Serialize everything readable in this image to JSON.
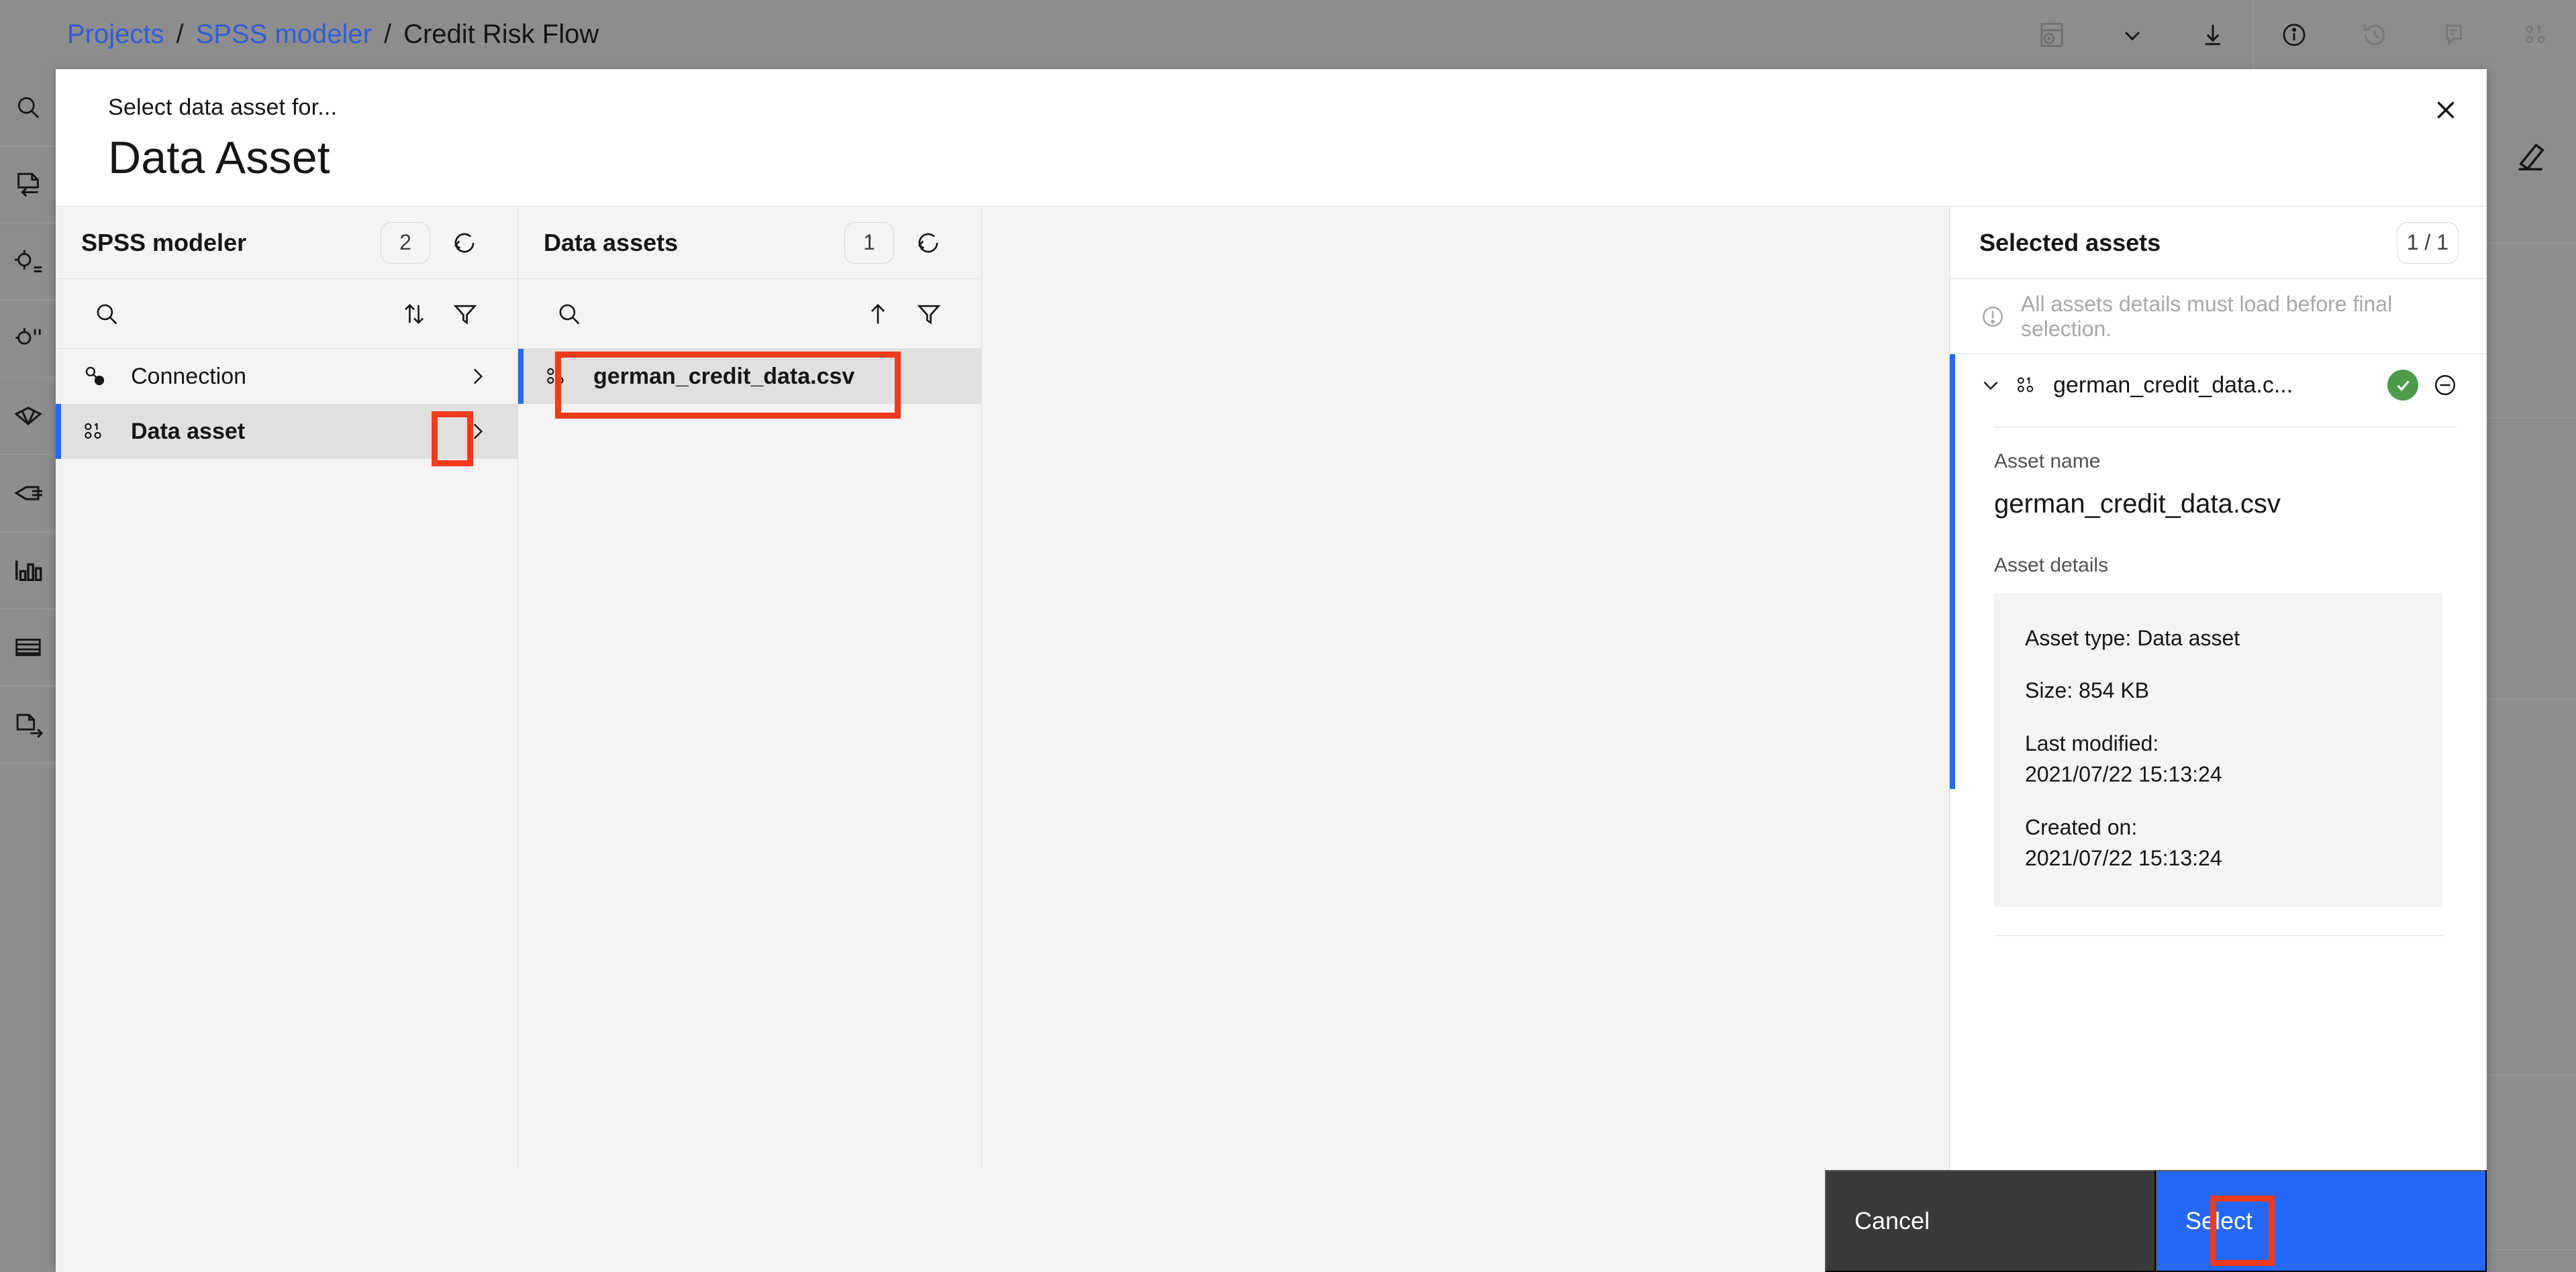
{
  "app": {
    "breadcrumb": [
      {
        "label": "Projects",
        "type": "link"
      },
      {
        "label": "/",
        "type": "sep"
      },
      {
        "label": "SPSS modeler",
        "type": "link"
      },
      {
        "label": "/",
        "type": "sep"
      },
      {
        "label": "Credit Risk Flow",
        "type": "current"
      }
    ],
    "toolbar_icons": [
      "run-flow-icon",
      "chevron-down-icon",
      "download-icon",
      "info-icon",
      "history-icon",
      "comment-icon",
      "data-asset-icon"
    ],
    "left_rail_icons": [
      "search-icon",
      "import-node-icon",
      "record-ops-icon",
      "field-ops-icon",
      "modeling-icon",
      "outputs-icon",
      "graphs-icon",
      "table-icon",
      "export-node-icon"
    ],
    "right_rail_icons": [
      "edit-pencil-icon"
    ]
  },
  "modal": {
    "eyebrow": "Select data asset for...",
    "title": "Data Asset",
    "close_label": "Close",
    "colors": {
      "accent_blue": "#2668f5",
      "annotation_red": "#ef3a1e",
      "status_green": "#4c9c4c",
      "cancel_dark": "#393939"
    },
    "columns": [
      {
        "name": "spss-modeler",
        "title": "SPSS modeler",
        "count": "2",
        "refresh_icon": "refresh-icon",
        "search_placeholder": "",
        "tools": [
          "search-icon",
          "sort-icon",
          "filter-icon"
        ],
        "items": [
          {
            "label": "Connection",
            "icon": "connection-icon",
            "selected": false,
            "chevron": true
          },
          {
            "label": "Data asset",
            "icon": "data-asset-icon",
            "selected": true,
            "chevron": true
          }
        ]
      },
      {
        "name": "data-assets",
        "title": "Data assets",
        "count": "1",
        "refresh_icon": "refresh-icon",
        "search_placeholder": "",
        "tools": [
          "search-icon",
          "sort-up-icon",
          "filter-icon"
        ],
        "items": [
          {
            "label": "german_credit_data.csv",
            "icon": "data-asset-icon",
            "selected": true,
            "chevron": false
          }
        ]
      }
    ],
    "selected_panel": {
      "title": "Selected assets",
      "count": "1 / 1",
      "notice_icon": "warning-circle-icon",
      "notice": "All assets details must load before final selection.",
      "item": {
        "expand_icon": "chevron-down-icon",
        "type_icon": "data-asset-icon",
        "name_truncated": "german_credit_data.c...",
        "status_icon": "check-circle-filled-icon",
        "remove_icon": "subtract-circle-icon"
      },
      "details": {
        "asset_name_label": "Asset name",
        "asset_name_value": "german_credit_data.csv",
        "asset_details_label": "Asset details",
        "lines": [
          "Asset type: Data asset",
          "Size: 854 KB",
          "Last modified:\n2021/07/22 15:13:24",
          "Created on:\n2021/07/22 15:13:24"
        ],
        "asset_type": "Asset type: Data asset",
        "size": "Size: 854 KB",
        "last_modified_label": "Last modified:",
        "last_modified_value": "2021/07/22 15:13:24",
        "created_on_label": "Created on:",
        "created_on_value": "2021/07/22 15:13:24"
      }
    },
    "footer": {
      "cancel_label": "Cancel",
      "select_label": "Select"
    }
  }
}
